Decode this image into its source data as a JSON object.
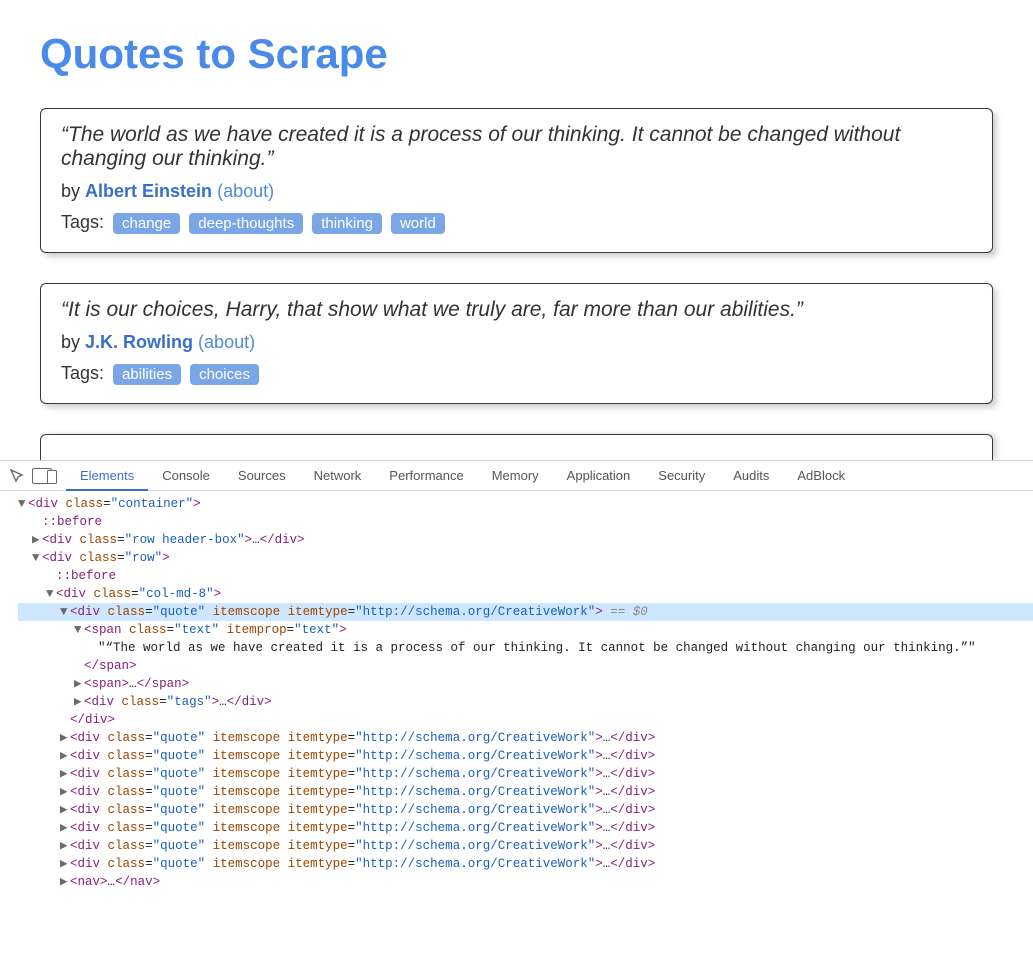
{
  "site": {
    "title": "Quotes to Scrape"
  },
  "byWord": "by",
  "aboutLabel": "(about)",
  "tagsLabel": "Tags:",
  "quotes": [
    {
      "text": "“The world as we have created it is a process of our thinking. It cannot be changed without changing our thinking.”",
      "author": "Albert Einstein",
      "tags": [
        "change",
        "deep-thoughts",
        "thinking",
        "world"
      ]
    },
    {
      "text": "“It is our choices, Harry, that show what we truly are, far more than our abilities.”",
      "author": "J.K. Rowling",
      "tags": [
        "abilities",
        "choices"
      ]
    }
  ],
  "devtools": {
    "tabs": [
      "Elements",
      "Console",
      "Sources",
      "Network",
      "Performance",
      "Memory",
      "Application",
      "Security",
      "Audits",
      "AdBlock"
    ],
    "activeTab": "Elements",
    "selectedSuffix": "== $0",
    "tree": {
      "container": "<div class=\"container\">",
      "pseudoBefore": "::before",
      "headerRow": "<div class=\"row header-box\">…</div>",
      "row": "<div class=\"row\">",
      "col": "<div class=\"col-md-8\">",
      "quoteOpen": "<div class=\"quote\" itemscope itemtype=\"http://schema.org/CreativeWork\">",
      "spanTextOpen": "<span class=\"text\" itemprop=\"text\">",
      "spanTextContent": "\"“The world as we have created it is a process of our thinking. It cannot be changed without changing our thinking.”\"",
      "spanClose": "</span>",
      "spanCollapsed": "<span>…</span>",
      "tagsDiv": "<div class=\"tags\">…</div>",
      "divClose": "</div>",
      "quoteCollapsed": "<div class=\"quote\" itemscope itemtype=\"http://schema.org/CreativeWork\">…</div>",
      "navCollapsed": "<nav>…</nav>",
      "collapsedCount": 8
    }
  }
}
